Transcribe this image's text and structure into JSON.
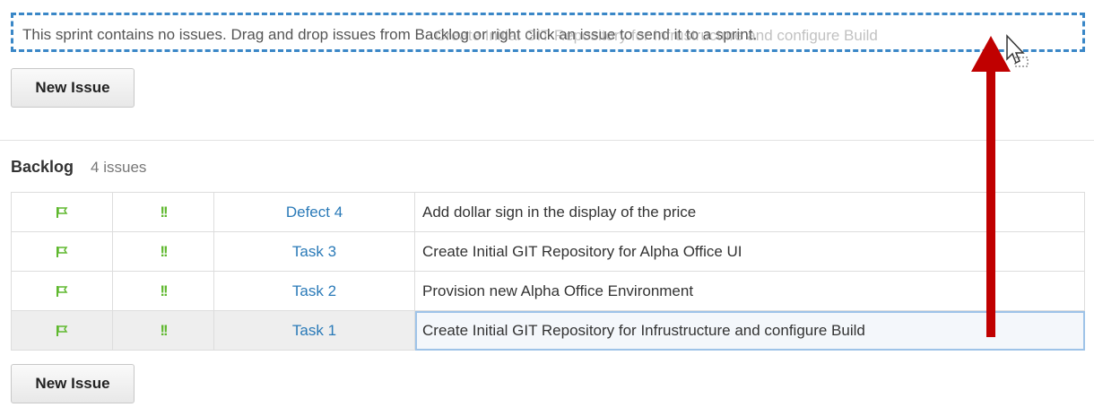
{
  "sprint": {
    "empty_message": "This sprint contains no issues. Drag and drop issues from Backlog or right click an issue to send it to a sprint.",
    "ghost_drag_text": "Create Initial GIT Repository for Infrustructure and configure Build",
    "new_issue_label": "New Issue"
  },
  "backlog": {
    "title": "Backlog",
    "count_label": "4 issues",
    "new_issue_label": "New Issue",
    "issues": [
      {
        "flag_icon": "flag-icon",
        "priority_icon": "!!",
        "id": "Defect 4",
        "summary": "Add dollar sign in the display of the price"
      },
      {
        "flag_icon": "flag-icon",
        "priority_icon": "!!",
        "id": "Task 3",
        "summary": "Create Initial GIT Repository for Alpha Office UI"
      },
      {
        "flag_icon": "flag-icon",
        "priority_icon": "!!",
        "id": "Task 2",
        "summary": "Provision new Alpha Office Environment"
      },
      {
        "flag_icon": "flag-icon",
        "priority_icon": "!!",
        "id": "Task 1",
        "summary": "Create Initial GIT Repository for Infrustructure and configure Build"
      }
    ]
  },
  "colors": {
    "accent_blue": "#3a87c7",
    "link_blue": "#2a7ab8",
    "priority_green": "#5fb82e",
    "arrow_red": "#c00000"
  }
}
